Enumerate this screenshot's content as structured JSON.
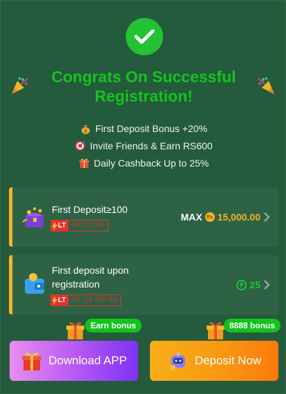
{
  "header": {
    "title": "Congrats On Successful Registration!"
  },
  "perks": [
    {
      "icon": "money-bag-icon",
      "text": "First Deposit Bonus +20%"
    },
    {
      "icon": "target-icon",
      "text": "Invite Friends & Earn RS600"
    },
    {
      "icon": "gift-icon",
      "text": "Daily Cashback Up to 25%"
    }
  ],
  "tasks": [
    {
      "title": "First Deposit≥100",
      "lt_label": "LT",
      "timer": "04:23:20",
      "reward_prefix": "MAX",
      "currency_symbol": "Rs",
      "reward": "15,000.00"
    },
    {
      "title": "First deposit upon registration",
      "lt_label": "LT",
      "timer": "6d 23:59:53",
      "reward": "25"
    }
  ],
  "actions": {
    "download": {
      "label": "Download APP",
      "tag": "Earn bonus"
    },
    "deposit": {
      "label": "Deposit Now",
      "tag": "8888 bonus"
    }
  },
  "colors": {
    "background": "#245b3c",
    "title_green": "#16c21f",
    "accent_gold": "#f0b623",
    "timer_red": "#e2322b",
    "reward_green": "#20c23c"
  }
}
